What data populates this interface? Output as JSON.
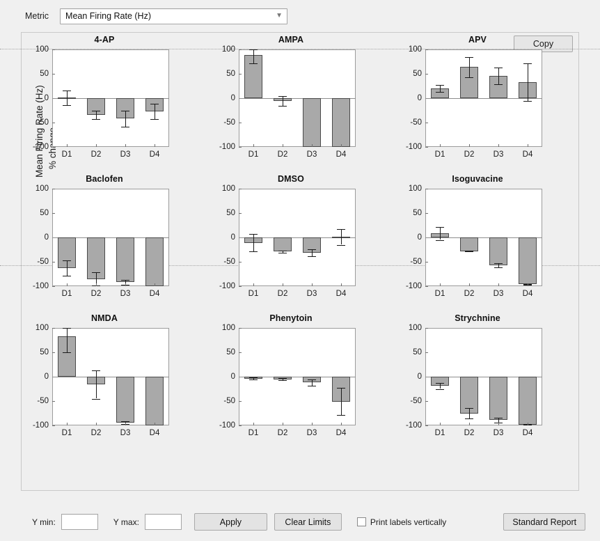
{
  "metric": {
    "label": "Metric",
    "selected": "Mean Firing Rate (Hz)",
    "caret": "chevron-down-icon"
  },
  "panel": {
    "copy_label": "Copy"
  },
  "axis": {
    "ylabel_line1": "Mean Firing Rate (Hz)",
    "ylabel_line2": "% change",
    "yticks": [
      "100",
      "50",
      "0",
      "-50",
      "-100"
    ],
    "ytick_values": [
      100,
      50,
      0,
      -50,
      -100
    ],
    "ylim": [
      -100,
      100
    ],
    "xticks": [
      "D1",
      "D2",
      "D3",
      "D4"
    ]
  },
  "toolbar": {
    "ymin_label": "Y min:",
    "ymin_value": "",
    "ymin_placeholder": "",
    "ymax_label": "Y max:",
    "ymax_value": "",
    "ymax_placeholder": "",
    "apply_label": "Apply",
    "clear_limits_label": "Clear Limits",
    "print_labels_vertically_label": "Print labels vertically",
    "print_labels_vertically_checked": false,
    "standard_report_label": "Standard Report"
  },
  "colors": {
    "bar_fill": "#a9a9a9",
    "bar_edge": "#4a4a4a",
    "background": "#f0f0f0",
    "panel_background": "#efefef",
    "axes_background": "#ffffff"
  },
  "chart_data": [
    {
      "type": "bar",
      "title": "4-AP",
      "categories": [
        "D1",
        "D2",
        "D3",
        "D4"
      ],
      "values": [
        1,
        -34,
        -42,
        -27
      ],
      "errors": [
        15,
        9,
        16,
        16
      ],
      "xlabel": "",
      "ylabel": "Mean Firing Rate (Hz) % change",
      "ylim": [
        -100,
        100
      ],
      "grid": false
    },
    {
      "type": "bar",
      "title": "AMPA",
      "categories": [
        "D1",
        "D2",
        "D3",
        "D4"
      ],
      "values": [
        88,
        -5,
        -100,
        -100
      ],
      "errors": [
        17,
        10,
        0,
        0
      ],
      "xlabel": "",
      "ylabel": "Mean Firing Rate (Hz) % change",
      "ylim": [
        -100,
        100
      ],
      "grid": false
    },
    {
      "type": "bar",
      "title": "APV",
      "categories": [
        "D1",
        "D2",
        "D3",
        "D4"
      ],
      "values": [
        20,
        64,
        46,
        33
      ],
      "errors": [
        7,
        21,
        17,
        39
      ],
      "xlabel": "",
      "ylabel": "Mean Firing Rate (Hz) % change",
      "ylim": [
        -100,
        100
      ],
      "grid": false
    },
    {
      "type": "bar",
      "title": "Baclofen",
      "categories": [
        "D1",
        "D2",
        "D3",
        "D4"
      ],
      "values": [
        -63,
        -85,
        -92,
        -100
      ],
      "errors": [
        16,
        13,
        5,
        0
      ],
      "xlabel": "",
      "ylabel": "Mean Firing Rate (Hz) % change",
      "ylim": [
        -100,
        100
      ],
      "grid": false
    },
    {
      "type": "bar",
      "title": "DMSO",
      "categories": [
        "D1",
        "D2",
        "D3",
        "D4"
      ],
      "values": [
        -11,
        -29,
        -31,
        1
      ],
      "errors": [
        18,
        2,
        7,
        16
      ],
      "xlabel": "",
      "ylabel": "Mean Firing Rate (Hz) % change",
      "ylim": [
        -100,
        100
      ],
      "grid": false
    },
    {
      "type": "bar",
      "title": "Isoguvacine",
      "categories": [
        "D1",
        "D2",
        "D3",
        "D4"
      ],
      "values": [
        8,
        -28,
        -57,
        -96
      ],
      "errors": [
        13,
        1,
        4,
        1
      ],
      "xlabel": "",
      "ylabel": "Mean Firing Rate (Hz) % change",
      "ylim": [
        -100,
        100
      ],
      "grid": false
    },
    {
      "type": "bar",
      "title": "NMDA",
      "categories": [
        "D1",
        "D2",
        "D3",
        "D4"
      ],
      "values": [
        83,
        -16,
        -94,
        -100
      ],
      "errors": [
        33,
        29,
        3,
        0
      ],
      "xlabel": "",
      "ylabel": "Mean Firing Rate (Hz) % change",
      "ylim": [
        -100,
        100
      ],
      "grid": false
    },
    {
      "type": "bar",
      "title": "Phenytoin",
      "categories": [
        "D1",
        "D2",
        "D3",
        "D4"
      ],
      "values": [
        -4,
        -5,
        -12,
        -51
      ],
      "errors": [
        2,
        2,
        6,
        28
      ],
      "xlabel": "",
      "ylabel": "Mean Firing Rate (Hz) % change",
      "ylim": [
        -100,
        100
      ],
      "grid": false
    },
    {
      "type": "bar",
      "title": "Strychnine",
      "categories": [
        "D1",
        "D2",
        "D3",
        "D4"
      ],
      "values": [
        -19,
        -75,
        -89,
        -98
      ],
      "errors": [
        6,
        11,
        5,
        1
      ],
      "xlabel": "",
      "ylabel": "Mean Firing Rate (Hz) % change",
      "ylim": [
        -100,
        100
      ],
      "grid": false
    }
  ]
}
